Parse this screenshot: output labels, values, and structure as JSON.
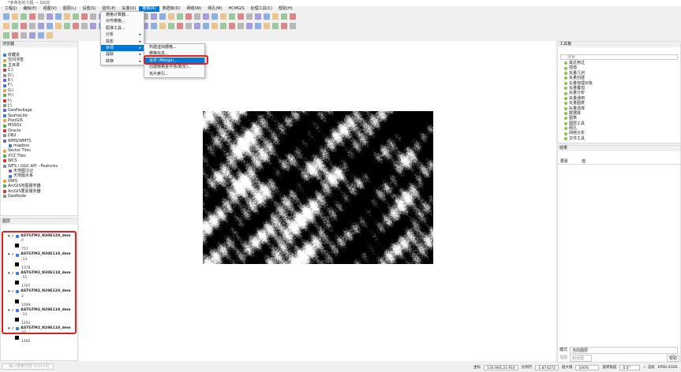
{
  "window_title": "*未命名的工程 — QGIS",
  "menubar": [
    "工程(J)",
    "编辑(E)",
    "视图(V)",
    "图层(L)",
    "设置(S)",
    "插件(P)",
    "矢量(O)",
    "栅格(R)",
    "数据库(D)",
    "网络(W)",
    "网孔(M)",
    "HCMGIS",
    "处理工具(C)",
    "帮助(H)"
  ],
  "raster_menu": {
    "items": [
      {
        "label": "栅格计算器...",
        "sub": false
      },
      {
        "label": "对齐栅格...",
        "sub": false
      },
      {
        "label": "配准工具...",
        "sub": false
      },
      {
        "label": "分析",
        "sub": true
      },
      {
        "label": "投影",
        "sub": true
      },
      {
        "label": "杂项",
        "sub": true
      },
      {
        "label": "提取",
        "sub": true
      },
      {
        "label": "转换",
        "sub": true
      }
    ],
    "arrow": "▸"
  },
  "misc_submenu": [
    "构建虚拟栅格...",
    "栅格信息...",
    "合并 (Merge)...",
    "创建栅格金字塔(概览)...",
    "瓦片索引..."
  ],
  "browser": {
    "title": "浏览器",
    "items": [
      "收藏夹",
      "空间书签",
      "主目录",
      "C:\\",
      "D:\\",
      "E:\\",
      "F:\\",
      "G:\\",
      "H:\\",
      "I:\\",
      "J:\\",
      "GeoPackage",
      "SpatiaLite",
      "PostGIS",
      "MSSQL",
      "Oracle",
      "DB2",
      "WMS/WMTS",
      "mapbox",
      "Vector Tiles",
      "XYZ Tiles",
      "WCS",
      "WFS / OGC API - Features",
      "天地图注记",
      "天地图水系",
      "OWS",
      "ArcGIS地图服务器",
      "ArcGIS要素服务器",
      "GeoNode"
    ]
  },
  "layers": {
    "title": "图层",
    "items": [
      {
        "name": "ASTGTM2_N30E120_dem",
        "min": "0",
        "max": "757"
      },
      {
        "name": "ASTGTM2_N30E119_dem",
        "min": "-13",
        "max": "1578"
      },
      {
        "name": "ASTGTM2_N30E118_dem",
        "min": "-51",
        "max": "1787"
      },
      {
        "name": "ASTGTM2_N29E120_dem",
        "min": "2",
        "max": "1099"
      },
      {
        "name": "ASTGTM2_N29E119_dem",
        "min": "-13",
        "max": "1293"
      },
      {
        "name": "ASTGTM2_N29E118_dem",
        "min": "20",
        "max": "1482"
      }
    ]
  },
  "toolbox": {
    "title": "工具箱",
    "search_placeholder": "搜索",
    "items": [
      "最近用过",
      "插值",
      "矢量几何",
      "矢量创建",
      "矢量地理对象",
      "矢量叠加",
      "矢量分析",
      "矢量通用",
      "矢量图表",
      "矢量选择",
      "数据库",
      "图表",
      "图层工具",
      "网孔",
      "网络分析",
      "文件工具"
    ]
  },
  "results": {
    "title": "结果",
    "col1": "要素",
    "col2": "值",
    "mode_label": "模式",
    "mode_value": "当前图层",
    "view_label": "视图",
    "view_value": "树状图",
    "help": "帮助"
  },
  "locate_placeholder": "输入搜索内容 (Ctrl+K)",
  "status": {
    "coord_label": "坐标",
    "coord": "116.960,31.914",
    "scale_label": "比例尺",
    "scale": "1:874273",
    "mag_label": "放大镜",
    "mag": "100%",
    "rot_label": "旋转角度",
    "rot": "0.0°",
    "render": "渲染",
    "crs": "EPSG:4326"
  },
  "colors": {
    "highlight": "#0078d7",
    "annotation": "#e02020"
  }
}
